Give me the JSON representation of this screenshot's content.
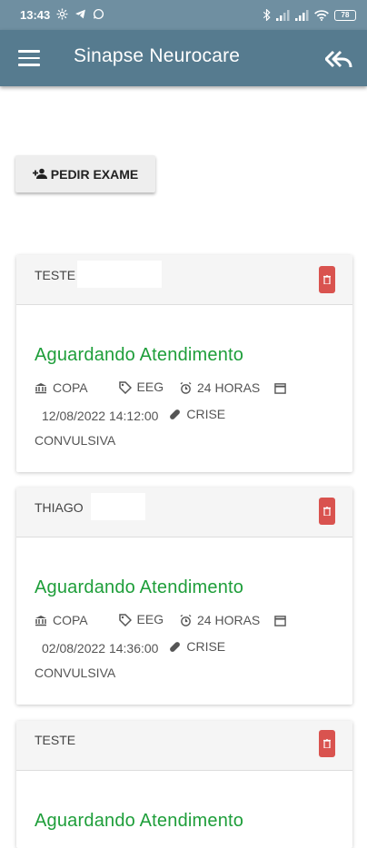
{
  "status_bar": {
    "time": "13:43",
    "battery": "78"
  },
  "app_bar": {
    "title": "Sinapse Neurocare"
  },
  "actions": {
    "pedir_exame_label": "PEDIR EXAME"
  },
  "cards": [
    {
      "patient": "TESTE",
      "status": "Aguardando Atendimento",
      "location": "COPA",
      "exam": "EEG",
      "duration": "24 HORAS",
      "datetime": "12/08/2022 14:12:00",
      "reason_1": "CRISE",
      "reason_2": "CONVULSIVA"
    },
    {
      "patient": "THIAGO",
      "status": "Aguardando Atendimento",
      "location": "COPA",
      "exam": "EEG",
      "duration": "24 HORAS",
      "datetime": "02/08/2022 14:36:00",
      "reason_1": "CRISE",
      "reason_2": "CONVULSIVA"
    },
    {
      "patient": "TESTE",
      "status": "Aguardando Atendimento"
    }
  ],
  "colors": {
    "app_bar": "#567b8f",
    "status_bar": "#6f8fa1",
    "status_text": "#1e9e3a",
    "delete": "#d9534f"
  }
}
